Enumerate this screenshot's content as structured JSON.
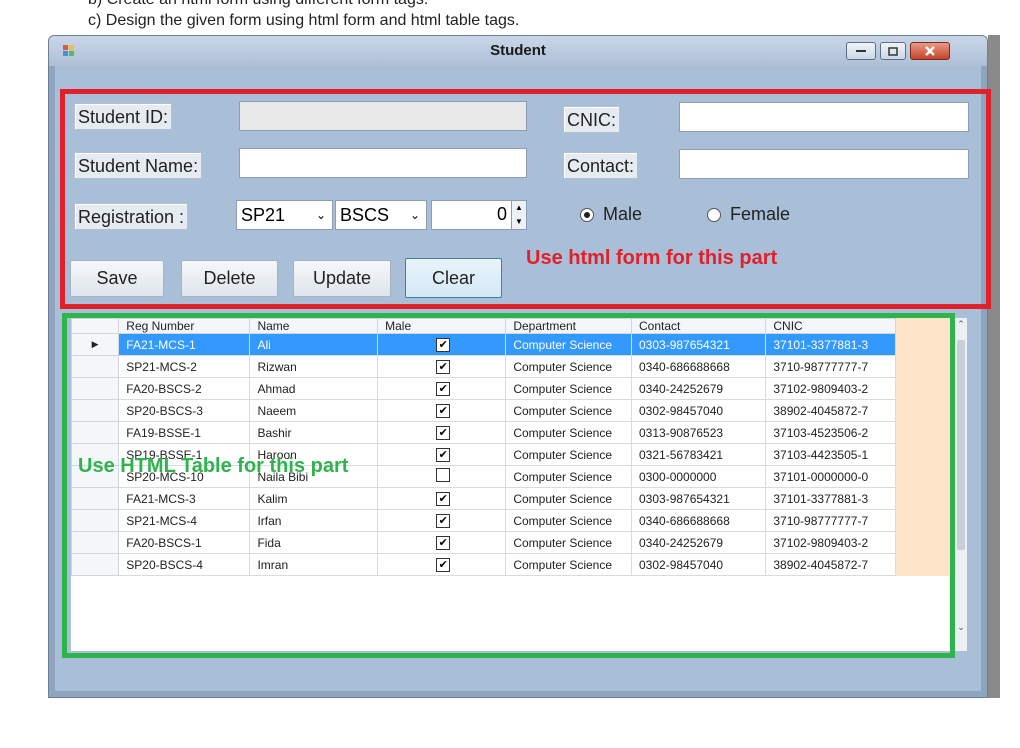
{
  "doc": {
    "line_b": "b) Create an html form using different form tags.",
    "line_c": "c) Design the given form using html form and html table tags."
  },
  "window": {
    "title": "Student",
    "icon": "app-icon",
    "minimize_icon": "minimize-icon",
    "maximize_icon": "maximize-icon",
    "close_icon": "close-icon"
  },
  "form": {
    "student_id_label": "Student ID:",
    "student_id_value": "",
    "cnic_label": "CNIC:",
    "cnic_value": "",
    "student_name_label": "Student Name:",
    "student_name_value": "",
    "contact_label": "Contact:",
    "contact_value": "",
    "registration_label": "Registration :",
    "session_value": "SP21",
    "program_value": "BSCS",
    "number_value": "0",
    "gender_male": "Male",
    "gender_female": "Female",
    "gender_selected": "Male"
  },
  "buttons": {
    "save": "Save",
    "delete": "Delete",
    "update": "Update",
    "clear": "Clear"
  },
  "annotations": {
    "form_note": "Use html form for this part",
    "table_note": "Use HTML Table for this part",
    "form_box_color": "#e0202a",
    "table_box_color": "#2fb34d"
  },
  "grid": {
    "columns": [
      "Reg Number",
      "Name",
      "Male",
      "Department",
      "Contact",
      "CNIC"
    ],
    "selected_row_color": "#3399ff",
    "rows": [
      {
        "reg": "FA21-MCS-1",
        "name": "Ali",
        "male": true,
        "dept": "Computer Science",
        "contact": "0303-987654321",
        "cnic": "37101-3377881-3"
      },
      {
        "reg": "SP21-MCS-2",
        "name": "Rizwan",
        "male": true,
        "dept": "Computer Science",
        "contact": "0340-686688668",
        "cnic": "3710-98777777-7"
      },
      {
        "reg": "FA20-BSCS-2",
        "name": "Ahmad",
        "male": true,
        "dept": "Computer Science",
        "contact": "0340-24252679",
        "cnic": "37102-9809403-2"
      },
      {
        "reg": "SP20-BSCS-3",
        "name": "Naeem",
        "male": true,
        "dept": "Computer Science",
        "contact": "0302-98457040",
        "cnic": "38902-4045872-7"
      },
      {
        "reg": "FA19-BSSE-1",
        "name": "Bashir",
        "male": true,
        "dept": "Computer Science",
        "contact": "0313-90876523",
        "cnic": "37103-4523506-2"
      },
      {
        "reg": "SP19-BSSE-1",
        "name": "Haroon",
        "male": true,
        "dept": "Computer Science",
        "contact": "0321-56783421",
        "cnic": "37103-4423505-1"
      },
      {
        "reg": "SP20-MCS-10",
        "name": "Naila Bibi",
        "male": false,
        "dept": "Computer Science",
        "contact": "0300-0000000",
        "cnic": "37101-0000000-0"
      },
      {
        "reg": "FA21-MCS-3",
        "name": "Kalim",
        "male": true,
        "dept": "Computer Science",
        "contact": "0303-987654321",
        "cnic": "37101-3377881-3"
      },
      {
        "reg": "SP21-MCS-4",
        "name": "Irfan",
        "male": true,
        "dept": "Computer Science",
        "contact": "0340-686688668",
        "cnic": "3710-98777777-7"
      },
      {
        "reg": "FA20-BSCS-1",
        "name": "Fida",
        "male": true,
        "dept": "Computer Science",
        "contact": "0340-24252679",
        "cnic": "37102-9809403-2"
      },
      {
        "reg": "SP20-BSCS-4",
        "name": "Imran",
        "male": true,
        "dept": "Computer Science",
        "contact": "0302-98457040",
        "cnic": "38902-4045872-7"
      }
    ]
  }
}
